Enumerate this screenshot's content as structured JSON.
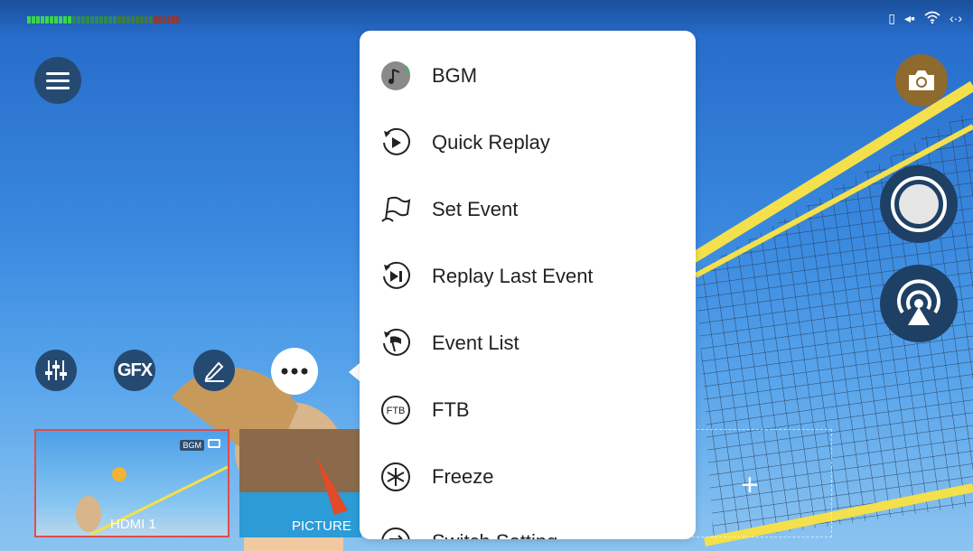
{
  "menu": [
    {
      "id": "bgm",
      "label": "BGM",
      "icon": "music-note-icon"
    },
    {
      "id": "quick-replay",
      "label": "Quick Replay",
      "icon": "replay-play-icon"
    },
    {
      "id": "set-event",
      "label": "Set Event",
      "icon": "flag-icon"
    },
    {
      "id": "replay-last-event",
      "label": "Replay Last Event",
      "icon": "replay-skip-icon"
    },
    {
      "id": "event-list",
      "label": "Event List",
      "icon": "event-flag-icon"
    },
    {
      "id": "ftb",
      "label": "FTB",
      "icon": "ftb-icon",
      "icon_text": "FTB"
    },
    {
      "id": "freeze",
      "label": "Freeze",
      "icon": "snowflake-icon"
    },
    {
      "id": "switch-settings",
      "label": "Switch Setting",
      "icon": "switch-icon"
    }
  ],
  "toolbar": {
    "gfx_label": "GFX"
  },
  "sources": [
    {
      "label": "HDMI 1",
      "badge": "BGM",
      "selected": true
    },
    {
      "label": "PICTURE",
      "selected": false
    }
  ],
  "colors": {
    "accent_red": "#e34b4b",
    "button_dark": "#254a72",
    "popup_bg": "#ffffff"
  }
}
